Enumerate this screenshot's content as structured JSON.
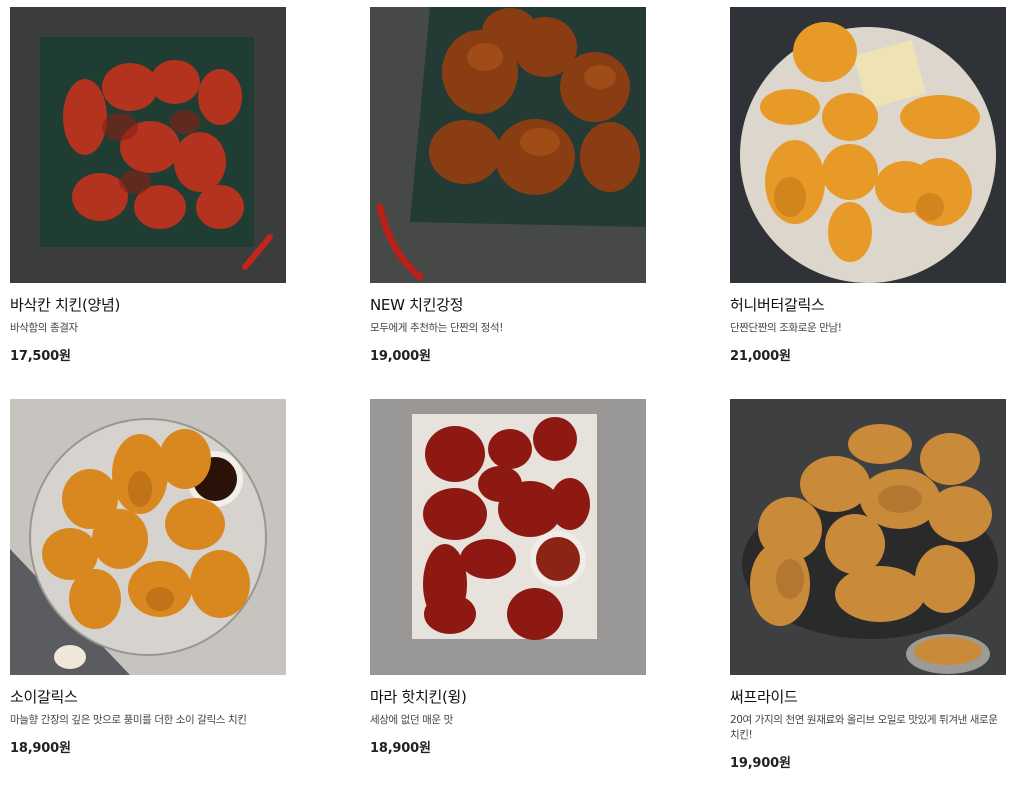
{
  "menu": {
    "items": [
      {
        "name": "바삭칸 치킨(양념)",
        "desc": "바삭함의 종결자",
        "price": "17,500원"
      },
      {
        "name": "NEW 치킨강정",
        "desc": "모두에게 추천하는 단짠의 정석!",
        "price": "19,000원"
      },
      {
        "name": "허니버터갈릭스",
        "desc": "단짠단짠의 조화로운 만남!",
        "price": "21,000원"
      },
      {
        "name": "소이갈릭스",
        "desc": "마늘향 간장의 깊은 맛으로 풍미를 더한 소이 갈릭스 치킨",
        "price": "18,900원"
      },
      {
        "name": "마라 핫치킨(윙)",
        "desc": "세상에 없던 매운 맛",
        "price": "18,900원"
      },
      {
        "name": "써프라이드",
        "desc": "20여 가지의 천연 원재료와 올리브 오일로 맛있게 튀겨낸 새로운 치킨!",
        "price": "19,900원"
      }
    ]
  }
}
